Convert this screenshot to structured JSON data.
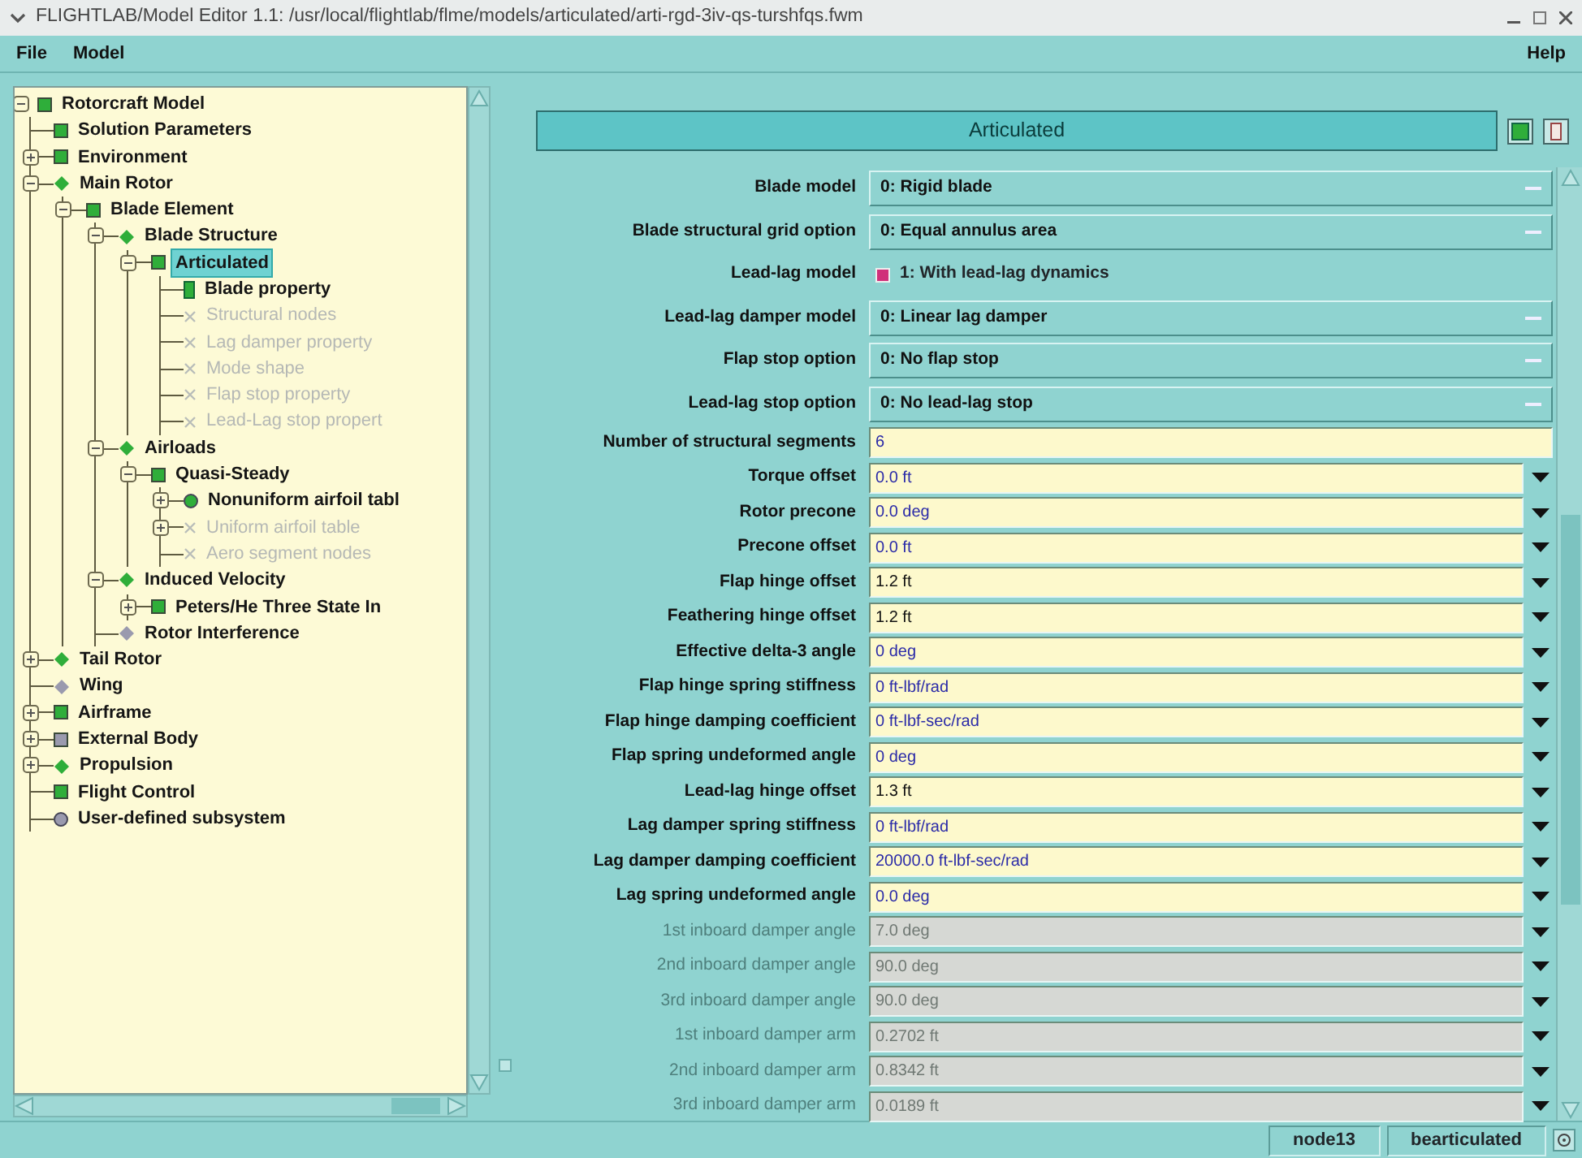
{
  "window": {
    "title": "FLIGHTLAB/Model Editor 1.1: /usr/local/flightlab/flme/models/articulated/arti-rgd-3iv-qs-turshfqs.fwm"
  },
  "menu": {
    "left": [
      "File",
      "Model"
    ],
    "right": [
      "Help"
    ]
  },
  "tree": [
    {
      "label": "Rotorcraft Model",
      "kind": "square",
      "color": "#2fae3a",
      "disabled": false,
      "selected": false,
      "expanded": true,
      "children": [
        {
          "label": "Solution Parameters",
          "kind": "square",
          "color": "#2fae3a",
          "disabled": false,
          "selected": false
        },
        {
          "label": "Environment",
          "kind": "square",
          "color": "#2fae3a",
          "disabled": false,
          "selected": false,
          "expanded": false
        },
        {
          "label": "Main Rotor",
          "kind": "diamond",
          "color": "#2fae3a",
          "disabled": false,
          "selected": false,
          "expanded": true,
          "children": [
            {
              "label": "Blade Element",
              "kind": "square",
              "color": "#2fae3a",
              "disabled": false,
              "selected": false,
              "expanded": true,
              "children": [
                {
                  "label": "Blade Structure",
                  "kind": "diamond",
                  "color": "#2fae3a",
                  "disabled": false,
                  "selected": false,
                  "expanded": true,
                  "children": [
                    {
                      "label": "Articulated",
                      "kind": "square",
                      "color": "#2fae3a",
                      "disabled": false,
                      "selected": true,
                      "expanded": true,
                      "children": [
                        {
                          "label": "Blade property",
                          "kind": "bar",
                          "color": "#2fae3a",
                          "disabled": false,
                          "selected": false
                        },
                        {
                          "label": "Structural nodes",
                          "kind": "cross",
                          "color": "#b9bdb9",
                          "disabled": true,
                          "selected": false
                        },
                        {
                          "label": "Lag damper property",
                          "kind": "cross",
                          "color": "#b9bdb9",
                          "disabled": true,
                          "selected": false
                        },
                        {
                          "label": "Mode shape",
                          "kind": "cross",
                          "color": "#b9bdb9",
                          "disabled": true,
                          "selected": false
                        },
                        {
                          "label": "Flap stop property",
                          "kind": "cross",
                          "color": "#b9bdb9",
                          "disabled": true,
                          "selected": false
                        },
                        {
                          "label": "Lead-Lag stop propert",
                          "kind": "cross",
                          "color": "#b9bdb9",
                          "disabled": true,
                          "selected": false
                        }
                      ]
                    }
                  ]
                },
                {
                  "label": "Airloads",
                  "kind": "diamond",
                  "color": "#2fae3a",
                  "disabled": false,
                  "selected": false,
                  "expanded": true,
                  "children": [
                    {
                      "label": "Quasi-Steady",
                      "kind": "square",
                      "color": "#2fae3a",
                      "disabled": false,
                      "selected": false,
                      "expanded": true,
                      "children": [
                        {
                          "label": "Nonuniform airfoil tabl",
                          "kind": "circle",
                          "color": "#2fae3a",
                          "disabled": false,
                          "selected": false,
                          "expanded": false
                        },
                        {
                          "label": "Uniform airfoil table",
                          "kind": "cross",
                          "color": "#b9bdb9",
                          "disabled": true,
                          "selected": false,
                          "expanded": false
                        },
                        {
                          "label": "Aero segment nodes",
                          "kind": "cross",
                          "color": "#b9bdb9",
                          "disabled": true,
                          "selected": false
                        }
                      ]
                    }
                  ]
                },
                {
                  "label": "Induced Velocity",
                  "kind": "diamond",
                  "color": "#2fae3a",
                  "disabled": false,
                  "selected": false,
                  "expanded": true,
                  "children": [
                    {
                      "label": "Peters/He Three State In",
                      "kind": "square",
                      "color": "#2fae3a",
                      "disabled": false,
                      "selected": false,
                      "expanded": false
                    }
                  ]
                },
                {
                  "label": "Rotor Interference",
                  "kind": "diamond",
                  "color": "#9a9aae",
                  "disabled": false,
                  "selected": false
                }
              ]
            }
          ]
        },
        {
          "label": "Tail Rotor",
          "kind": "diamond",
          "color": "#2fae3a",
          "disabled": false,
          "selected": false,
          "expanded": false
        },
        {
          "label": "Wing",
          "kind": "diamond",
          "color": "#9a9aae",
          "disabled": false,
          "selected": false
        },
        {
          "label": "Airframe",
          "kind": "square",
          "color": "#2fae3a",
          "disabled": false,
          "selected": false,
          "expanded": false
        },
        {
          "label": "External Body",
          "kind": "square",
          "color": "#9a9aae",
          "disabled": false,
          "selected": false,
          "expanded": false
        },
        {
          "label": "Propulsion",
          "kind": "diamond",
          "color": "#2fae3a",
          "disabled": false,
          "selected": false,
          "expanded": false
        },
        {
          "label": "Flight Control",
          "kind": "square",
          "color": "#2fae3a",
          "disabled": false,
          "selected": false
        },
        {
          "label": "User-defined subsystem",
          "kind": "circle",
          "color": "#9a9aae",
          "disabled": false,
          "selected": false
        }
      ]
    }
  ],
  "editor": {
    "title": "Articulated",
    "fields": [
      {
        "kind": "dropdown",
        "label": "Blade model",
        "value": "0: Rigid blade",
        "disabled": false
      },
      {
        "kind": "dropdown",
        "label": "Blade structural grid option",
        "value": "0: Equal annulus area",
        "disabled": false
      },
      {
        "kind": "toggle",
        "label": "Lead-lag model",
        "value": "1: With lead-lag dynamics",
        "disabled": false,
        "checked": true
      },
      {
        "kind": "dropdown",
        "label": "Lead-lag damper model",
        "value": "0: Linear lag damper",
        "disabled": false
      },
      {
        "kind": "dropdown",
        "label": "Flap stop option",
        "value": "0: No flap stop",
        "disabled": false
      },
      {
        "kind": "dropdown",
        "label": "Lead-lag stop option",
        "value": "0: No lead-lag stop",
        "disabled": false
      },
      {
        "kind": "text",
        "label": "Number of structural segments",
        "value": "6",
        "disabled": false,
        "color": "#2a2aa8"
      },
      {
        "kind": "unit",
        "label": "Torque offset",
        "value": "0.0 ft",
        "disabled": false,
        "color": "#2a2aa8"
      },
      {
        "kind": "unit",
        "label": "Rotor precone",
        "value": "0.0 deg",
        "disabled": false,
        "color": "#2a2aa8"
      },
      {
        "kind": "unit",
        "label": "Precone offset",
        "value": "0.0 ft",
        "disabled": false,
        "color": "#2a2aa8"
      },
      {
        "kind": "unit",
        "label": "Flap hinge offset",
        "value": "1.2 ft",
        "disabled": false,
        "color": "#111111"
      },
      {
        "kind": "unit",
        "label": "Feathering hinge offset",
        "value": "1.2 ft",
        "disabled": false,
        "color": "#111111"
      },
      {
        "kind": "unit",
        "label": "Effective delta-3 angle",
        "value": "0 deg",
        "disabled": false,
        "color": "#2a2aa8"
      },
      {
        "kind": "unit",
        "label": "Flap hinge spring stiffness",
        "value": "0 ft-lbf/rad",
        "disabled": false,
        "color": "#2a2aa8"
      },
      {
        "kind": "unit",
        "label": "Flap hinge damping coefficient",
        "value": "0 ft-lbf-sec/rad",
        "disabled": false,
        "color": "#2a2aa8"
      },
      {
        "kind": "unit",
        "label": "Flap spring undeformed angle",
        "value": "0 deg",
        "disabled": false,
        "color": "#2a2aa8"
      },
      {
        "kind": "unit",
        "label": "Lead-lag hinge offset",
        "value": "1.3 ft",
        "disabled": false,
        "color": "#111111"
      },
      {
        "kind": "unit",
        "label": "Lag damper spring stiffness",
        "value": "0 ft-lbf/rad",
        "disabled": false,
        "color": "#2a2aa8"
      },
      {
        "kind": "unit",
        "label": "Lag damper damping coefficient",
        "value": "20000.0 ft-lbf-sec/rad",
        "disabled": false,
        "color": "#2a2aa8"
      },
      {
        "kind": "unit",
        "label": "Lag spring undeformed angle",
        "value": "0.0 deg",
        "disabled": false,
        "color": "#2a2aa8"
      },
      {
        "kind": "unit",
        "label": "1st inboard damper angle",
        "value": "7.0 deg",
        "disabled": true
      },
      {
        "kind": "unit",
        "label": "2nd inboard damper angle",
        "value": "90.0 deg",
        "disabled": true
      },
      {
        "kind": "unit",
        "label": "3rd inboard damper angle",
        "value": "90.0 deg",
        "disabled": true
      },
      {
        "kind": "unit",
        "label": "1st inboard damper arm",
        "value": "0.2702 ft",
        "disabled": true
      },
      {
        "kind": "unit",
        "label": "2nd inboard damper arm",
        "value": "0.8342 ft",
        "disabled": true
      },
      {
        "kind": "unit",
        "label": "3rd inboard damper arm",
        "value": "0.0189 ft",
        "disabled": true
      }
    ]
  },
  "status_bar": [
    "node13",
    "bearticulated"
  ]
}
